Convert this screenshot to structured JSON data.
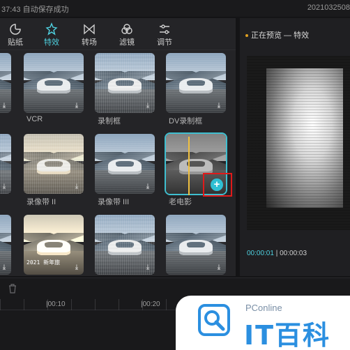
{
  "titlebar": {
    "left_text": "37:43 自动保存成功",
    "right_text": "2021032508"
  },
  "tabs": [
    {
      "label": "贴纸",
      "icon": "sticker-icon"
    },
    {
      "label": "特效",
      "icon": "sparkle-icon",
      "active": true
    },
    {
      "label": "转场",
      "icon": "transition-icon"
    },
    {
      "label": "滤镜",
      "icon": "filter-icon"
    },
    {
      "label": "调节",
      "icon": "adjust-icon"
    }
  ],
  "effects": [
    {
      "label": "VCR",
      "overlay": ""
    },
    {
      "label": "录制框",
      "overlay": ""
    },
    {
      "label": "DV录制框",
      "overlay": ""
    },
    {
      "label": "录像带 II",
      "overlay": ""
    },
    {
      "label": "录像带 III",
      "overlay": ""
    },
    {
      "label": "老电影",
      "overlay": "",
      "selected": true
    },
    {
      "label": "",
      "overlay": ""
    },
    {
      "label": "",
      "overlay": "2021 新年旅"
    },
    {
      "label": "",
      "overlay": ""
    }
  ],
  "preview": {
    "title": "正在预览 — 特效",
    "current_time": "00:00:01",
    "separator": "|",
    "total_time": "00:00:03"
  },
  "timeline": {
    "ticks": [
      "|00:10",
      "|00:20"
    ]
  },
  "watermark": {
    "small": "PConline",
    "big": "IT百科"
  },
  "colors": {
    "accent": "#4fd1e0",
    "highlight_box": "#e01a1a"
  }
}
